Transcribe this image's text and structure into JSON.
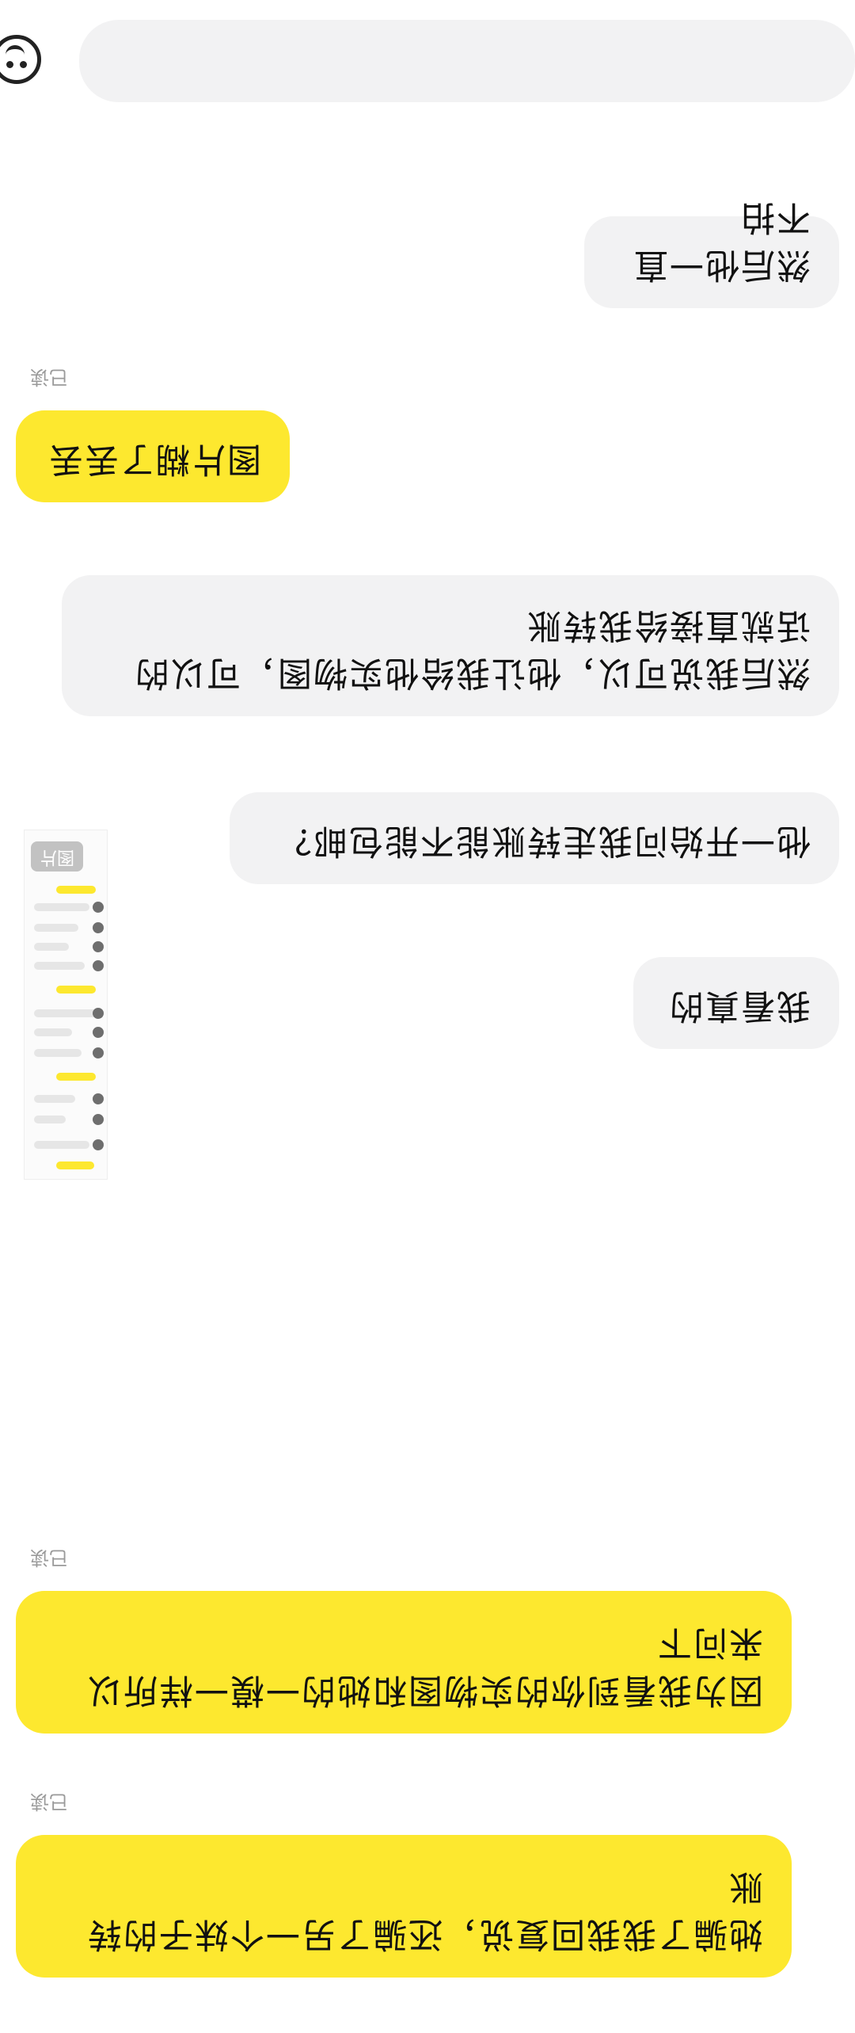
{
  "input_bar": {
    "placeholder": ""
  },
  "messages": [
    {
      "side": "me",
      "read": "已读",
      "text": "她骗了我我回复说，还骗了另一个妹子的转"
    },
    {
      "side": "me",
      "text": "账"
    },
    {
      "side": "me",
      "read": "已读",
      "text": "因为我看到你的实物图和她的一模一样所以"
    },
    {
      "side": "me",
      "text": "来问下"
    },
    {
      "side": "other",
      "thumbnail_tag": "图片"
    },
    {
      "side": "other",
      "text": "我看真的"
    },
    {
      "side": "other",
      "text": "他一开始问我走转账能不能包邮？"
    },
    {
      "side": "other",
      "text": "然后我说可以，他让我给他实物图，可以的"
    },
    {
      "side": "other",
      "text": "话就直接给我转账"
    },
    {
      "side": "me",
      "read": "已读",
      "text": "图片糊了丢丢"
    },
    {
      "side": "other",
      "text": "然后他一直不拍"
    }
  ],
  "colors": {
    "my_bubble": "#fde82f",
    "other_bubble": "#f2f2f3",
    "read_text": "#9a9a9a",
    "background": "#ffffff"
  },
  "icons": {
    "emoji": "emoji-face-icon"
  }
}
